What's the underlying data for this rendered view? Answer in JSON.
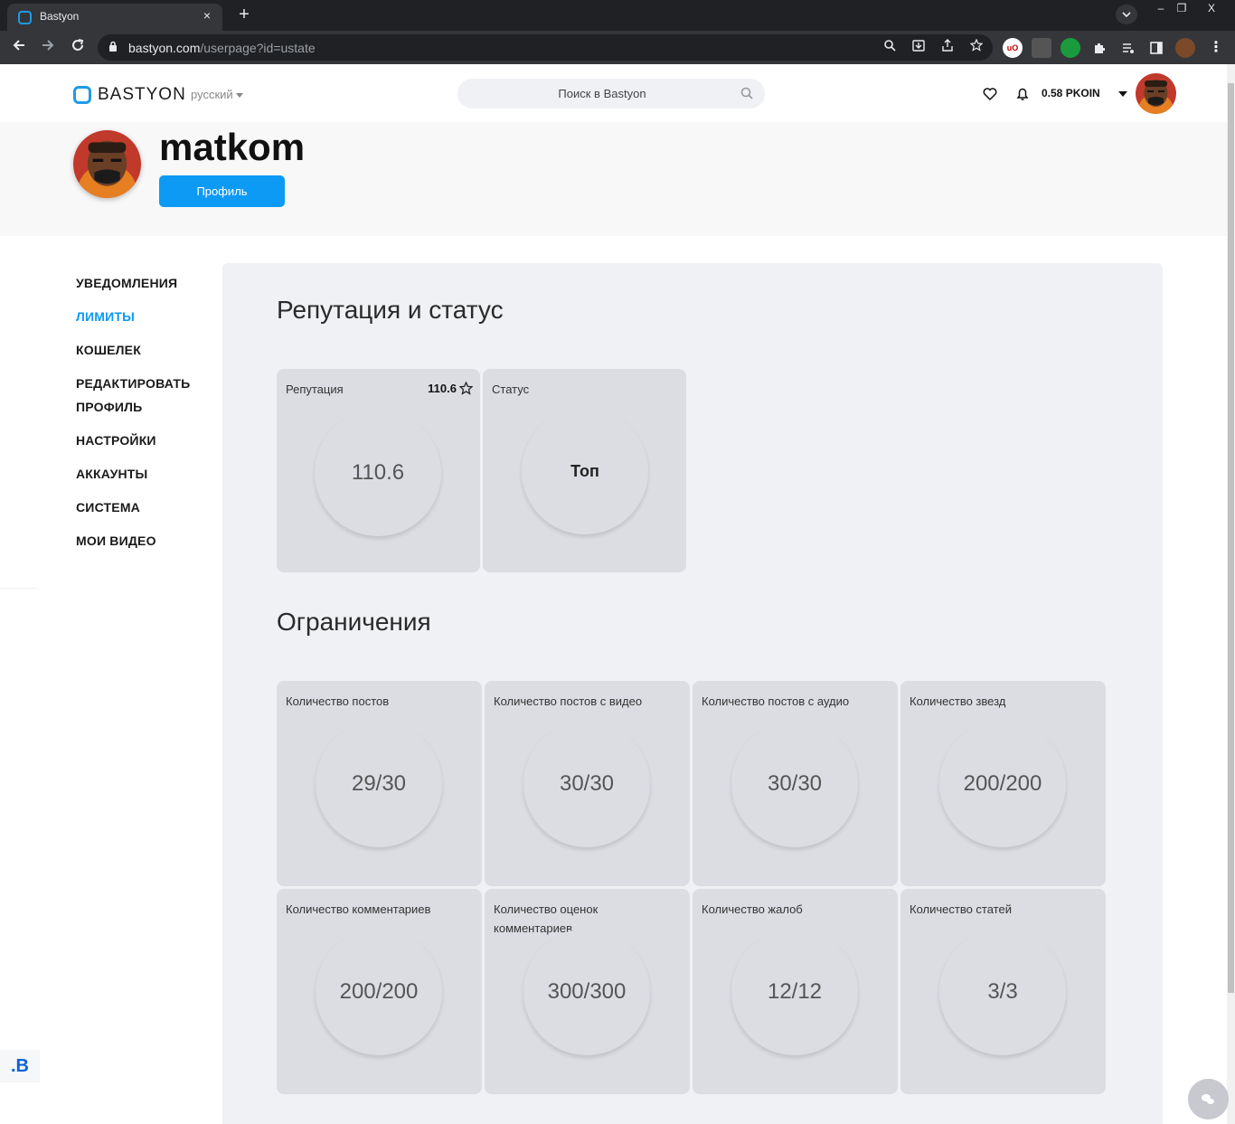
{
  "browser": {
    "tab_title": "Bastyon",
    "tab_close": "×",
    "new_tab": "+",
    "url_host": "bastyon.com",
    "url_path": "/userpage?id=ustate",
    "window": {
      "minimize": "–",
      "restore": "❐",
      "close": "X"
    }
  },
  "header": {
    "logo_text": "BASTYON",
    "language": "русский",
    "search_placeholder": "Поиск в Bastyon",
    "balance": "0.58 PKOIN"
  },
  "profile": {
    "username": "matkom",
    "profile_button": "Профиль"
  },
  "sidebar": {
    "items": [
      {
        "label": "УВЕДОМЛЕНИЯ",
        "active": false
      },
      {
        "label": "ЛИМИТЫ",
        "active": true
      },
      {
        "label": "КОШЕЛЕК",
        "active": false
      },
      {
        "label": "РЕДАКТИРОВАТЬ ПРОФИЛЬ",
        "active": false
      },
      {
        "label": "НАСТРОЙКИ",
        "active": false
      },
      {
        "label": "АККАУНТЫ",
        "active": false
      },
      {
        "label": "СИСТЕМА",
        "active": false
      },
      {
        "label": "МОИ ВИДЕО",
        "active": false
      }
    ]
  },
  "reputation": {
    "section_title": "Репутация и статус",
    "reputation_card": {
      "label": "Репутация",
      "badge_value": "110.6",
      "value": "110.6"
    },
    "status_card": {
      "label": "Статус",
      "value": "Топ"
    }
  },
  "limits": {
    "section_title": "Ограничения",
    "items": [
      {
        "label": "Количество постов",
        "value": "29/30"
      },
      {
        "label": "Количество постов с видео",
        "value": "30/30"
      },
      {
        "label": "Количество постов с аудио",
        "value": "30/30"
      },
      {
        "label": "Количество звезд",
        "value": "200/200"
      },
      {
        "label": "Количество комментариев",
        "value": "200/200"
      },
      {
        "label": "Количество оценок комментариев",
        "value": "300/300"
      },
      {
        "label": "Количество жалоб",
        "value": "12/12"
      },
      {
        "label": "Количество статей",
        "value": "3/3"
      }
    ]
  },
  "misc": {
    "b_badge": ".B"
  },
  "colors": {
    "accent": "#0d9af5",
    "panel_bg": "#f0f1f4",
    "card_bg": "#dcdde3"
  }
}
